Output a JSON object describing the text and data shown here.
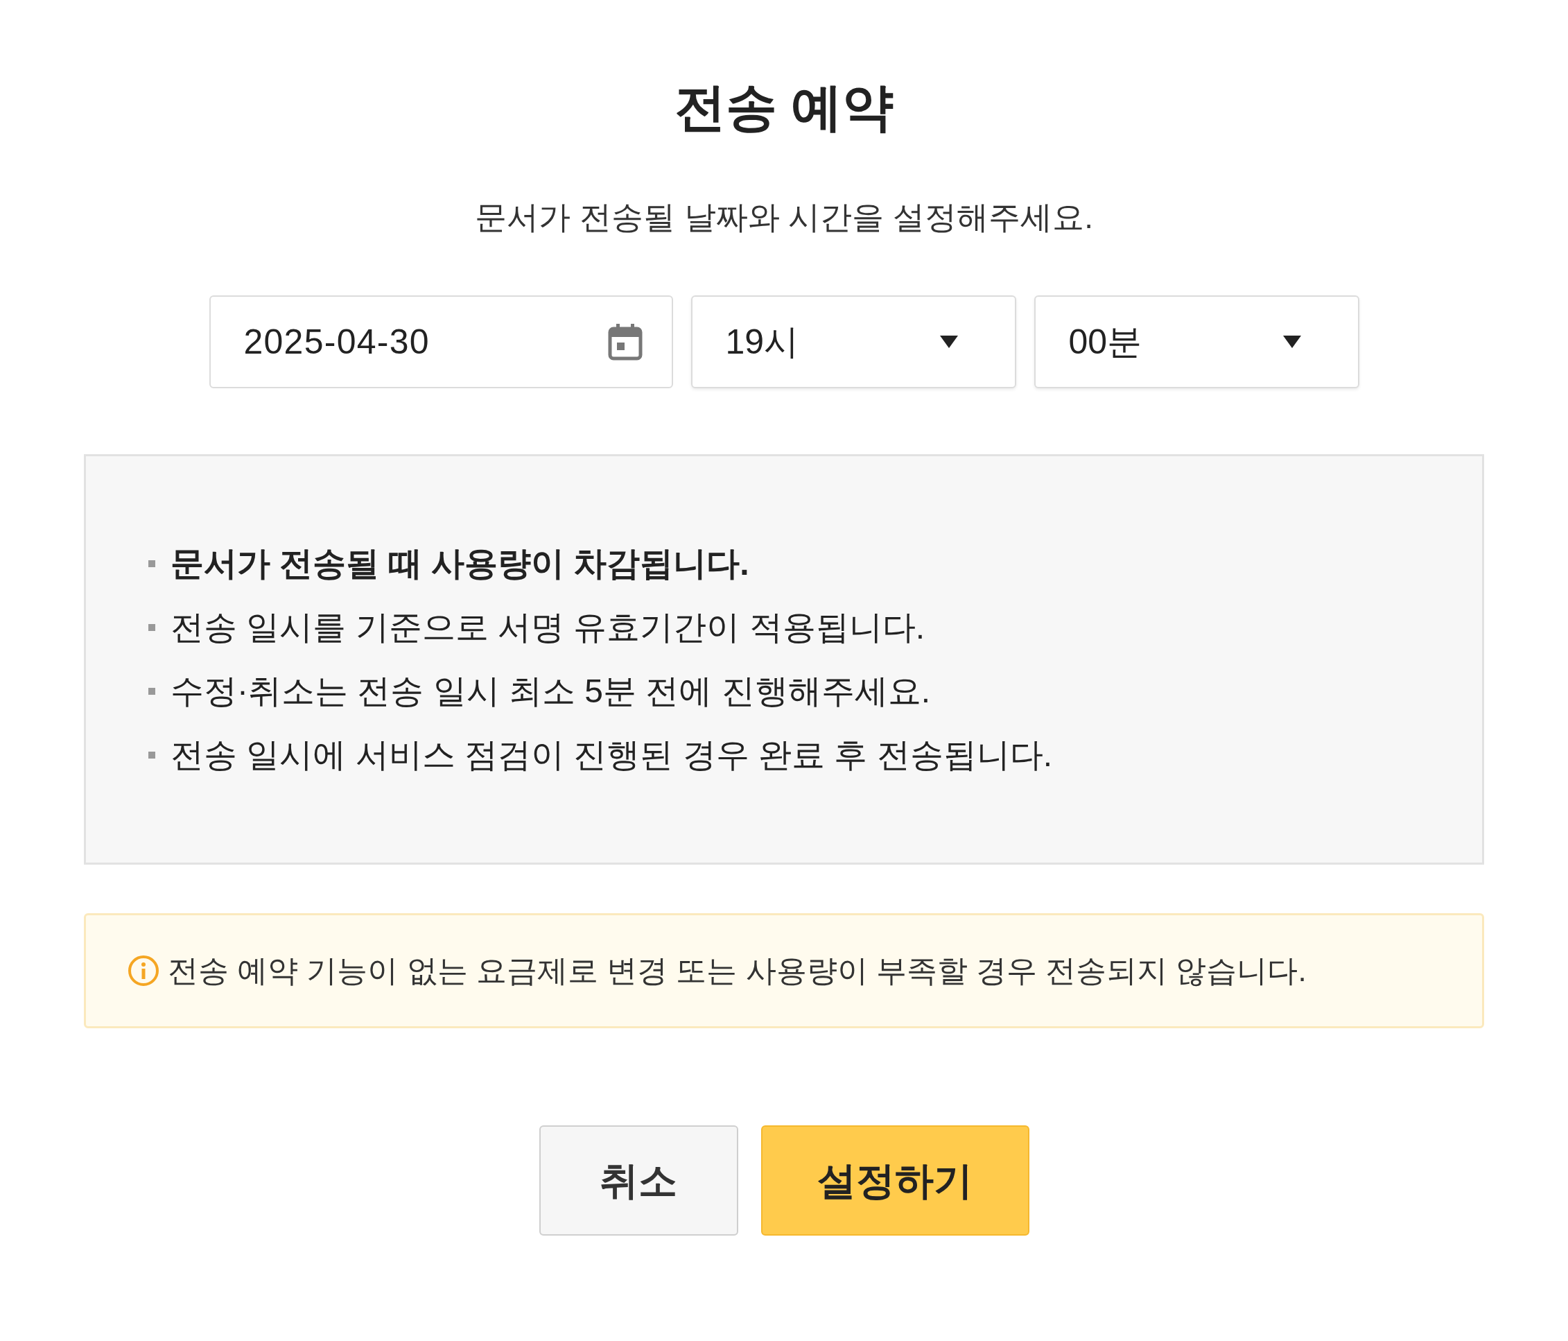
{
  "title": "전송 예약",
  "description": "문서가 전송될 날짜와 시간을 설정해주세요.",
  "date_field": {
    "value": "2025-04-30"
  },
  "hour_select": {
    "value": "19시"
  },
  "minute_select": {
    "value": "00분"
  },
  "notices": [
    {
      "text": "문서가 전송될 때 사용량이 차감됩니다.",
      "bold": true
    },
    {
      "text": "전송 일시를 기준으로 서명 유효기간이 적용됩니다.",
      "bold": false
    },
    {
      "text": "수정·취소는 전송 일시 최소 5분 전에 진행해주세요.",
      "bold": false
    },
    {
      "text": "전송 일시에 서비스 점검이 진행된 경우 완료 후 전송됩니다.",
      "bold": false
    }
  ],
  "warning": "전송 예약 기능이 없는 요금제로 변경 또는 사용량이 부족할 경우 전송되지 않습니다.",
  "buttons": [
    {
      "label": "취소",
      "kind": "secondary"
    },
    {
      "label": "설정하기",
      "kind": "primary"
    }
  ]
}
